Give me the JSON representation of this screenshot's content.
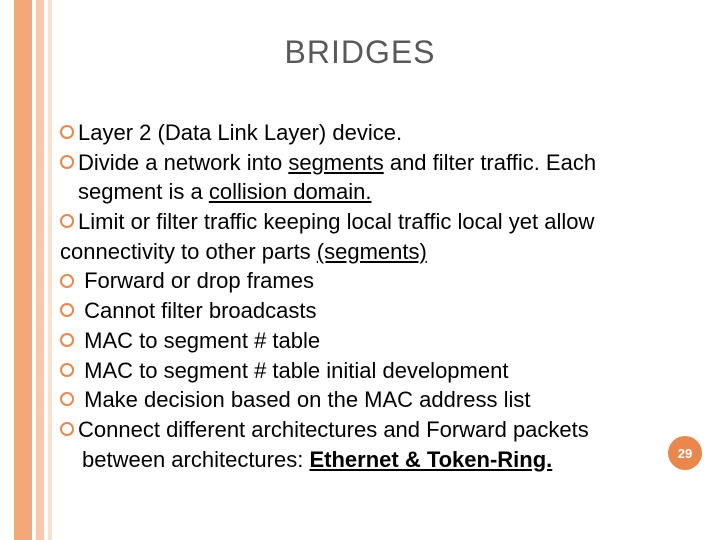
{
  "title": "BRIDGES",
  "page_number": "29",
  "lines": {
    "l1a": "Layer",
    "l1b": " 2 (Data Link Layer) device.",
    "l2a": "Divide",
    "l2b": " a network into ",
    "l2c": "segments",
    "l2d": " and filter traffic. Each",
    "l3": "segment is a ",
    "l3u": "collision domain.",
    "l4a": "Limit",
    "l4b": " or filter traffic keeping local  traffic local yet allow",
    "l5a": "connectivity to other parts ",
    "l5u": "(segments)",
    "l6": " Forward or drop frames",
    "l7": " Cannot filter broadcasts",
    "l8": " MAC to segment # table",
    "l9": " MAC to segment # table initial development",
    "l10": " Make decision based on the MAC address list",
    "l11a": "Connect",
    "l11b": " different architectures and Forward packets",
    "l12a": "between architectures: ",
    "l12b": "Ethernet & Token-Ring."
  }
}
